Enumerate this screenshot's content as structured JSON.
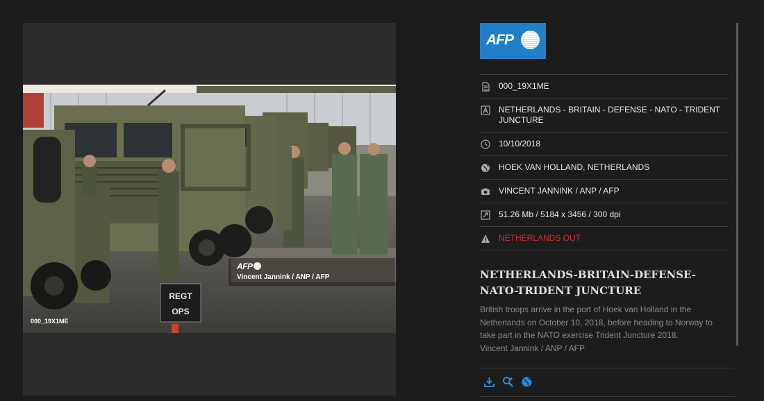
{
  "photo": {
    "watermark_logo": "AFP",
    "watermark_credit": "Vincent Jannink / ANP / AFP",
    "photo_id": "000_19X1ME",
    "sign_line1": "REGT",
    "sign_line2": "OPS"
  },
  "brand": {
    "logo_text": "AFP",
    "accent_color": "#1f7fc9",
    "warning_color": "#c8323c"
  },
  "meta": {
    "id": "000_19X1ME",
    "keywords": "NETHERLANDS - BRITAIN - DEFENSE - NATO - TRIDENT JUNCTURE",
    "date": "10/10/2018",
    "location": "HOEK VAN HOLLAND, NETHERLANDS",
    "credit": "VINCENT JANNINK / ANP / AFP",
    "file_info": "51.26 Mb / 5184 x 3456 / 300 dpi",
    "restriction": "NETHERLANDS OUT"
  },
  "headline": "NETHERLANDS-BRITAIN-DEFENSE-NATO-TRIDENT JUNCTURE",
  "caption": {
    "text": "British troops arrive in the port of Hoek van Holland in the Netherlands on October 10, 2018, before heading to Norway to take part in the NATO exercise Trident Juncture 2018.",
    "credit": "Vincent Jannink / ANP / AFP"
  },
  "icons": {
    "id": "document-icon",
    "keywords": "text-icon",
    "date": "clock-icon",
    "location": "globe-icon",
    "credit": "camera-icon",
    "file_info": "resize-icon",
    "restriction": "warning-icon",
    "download": "download-icon",
    "zoom": "zoom-in-icon",
    "share": "globe-icon"
  }
}
